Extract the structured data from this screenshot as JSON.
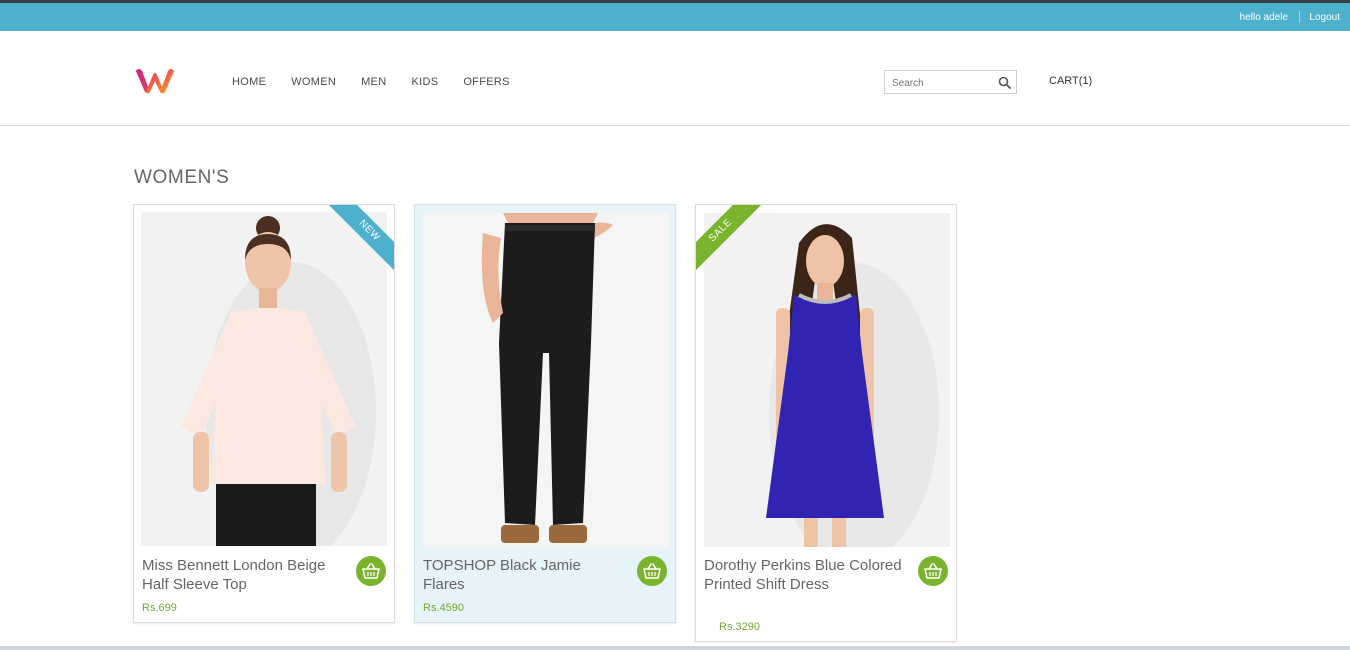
{
  "topbar": {
    "greeting": "hello adele",
    "logout": "Logout"
  },
  "header": {
    "nav": [
      "HOME",
      "WOMEN",
      "MEN",
      "KIDS",
      "OFFERS"
    ],
    "search_placeholder": "Search",
    "cart": "CART(1)"
  },
  "section": {
    "title": "WOMEN'S"
  },
  "products": [
    {
      "name": "Miss Bennett London Beige Half Sleeve Top",
      "price": "Rs.699",
      "badge": "NEW"
    },
    {
      "name": "TOPSHOP Black Jamie Flares",
      "price": "Rs.4590",
      "badge": ""
    },
    {
      "name": "Dorothy Perkins Blue Colored Printed Shift Dress",
      "price": "Rs.3290",
      "badge": "SALE"
    }
  ],
  "colors": {
    "topbar": "#4db0cc",
    "accent_green": "#7ab32e",
    "highlight_card": "#e6f3f8"
  },
  "icons": {
    "search": "search-icon",
    "basket": "basket-icon",
    "logo": "brand-logo"
  }
}
